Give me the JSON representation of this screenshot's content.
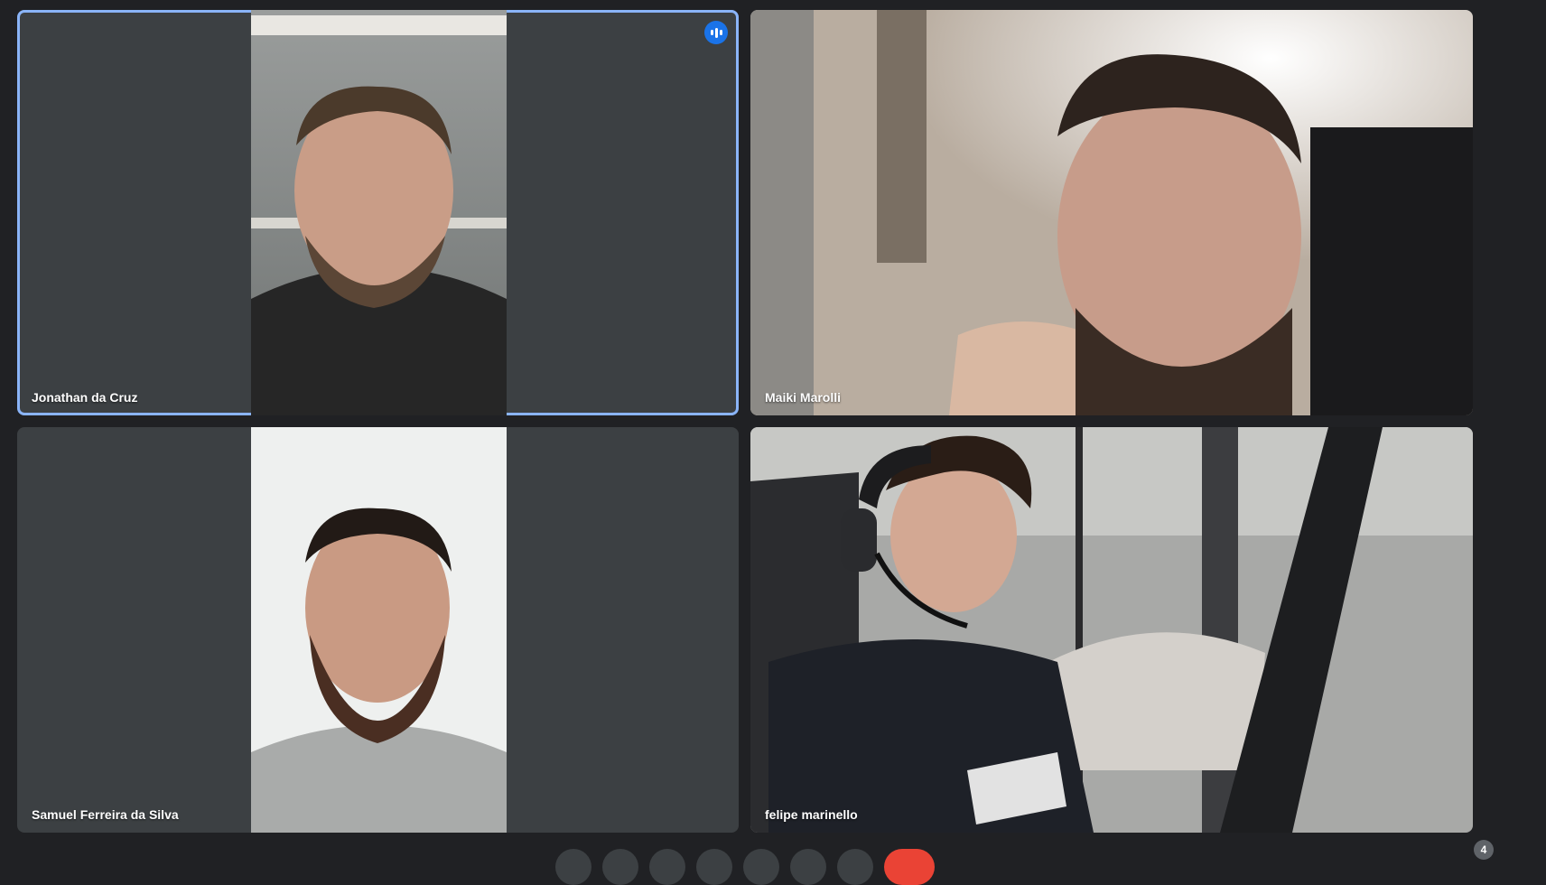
{
  "participants": [
    {
      "name": "Jonathan da Cruz",
      "speaking": true
    },
    {
      "name": "Maiki Marolli"
    },
    {
      "name": "Samuel Ferreira da Silva"
    },
    {
      "name": "felipe marinello"
    }
  ],
  "participant_count": "4",
  "colors": {
    "background": "#202124",
    "tile": "#3c4043",
    "active_border": "#8ab4f8",
    "speaking_indicator": "#1a73e8",
    "end_call": "#ea4335"
  }
}
